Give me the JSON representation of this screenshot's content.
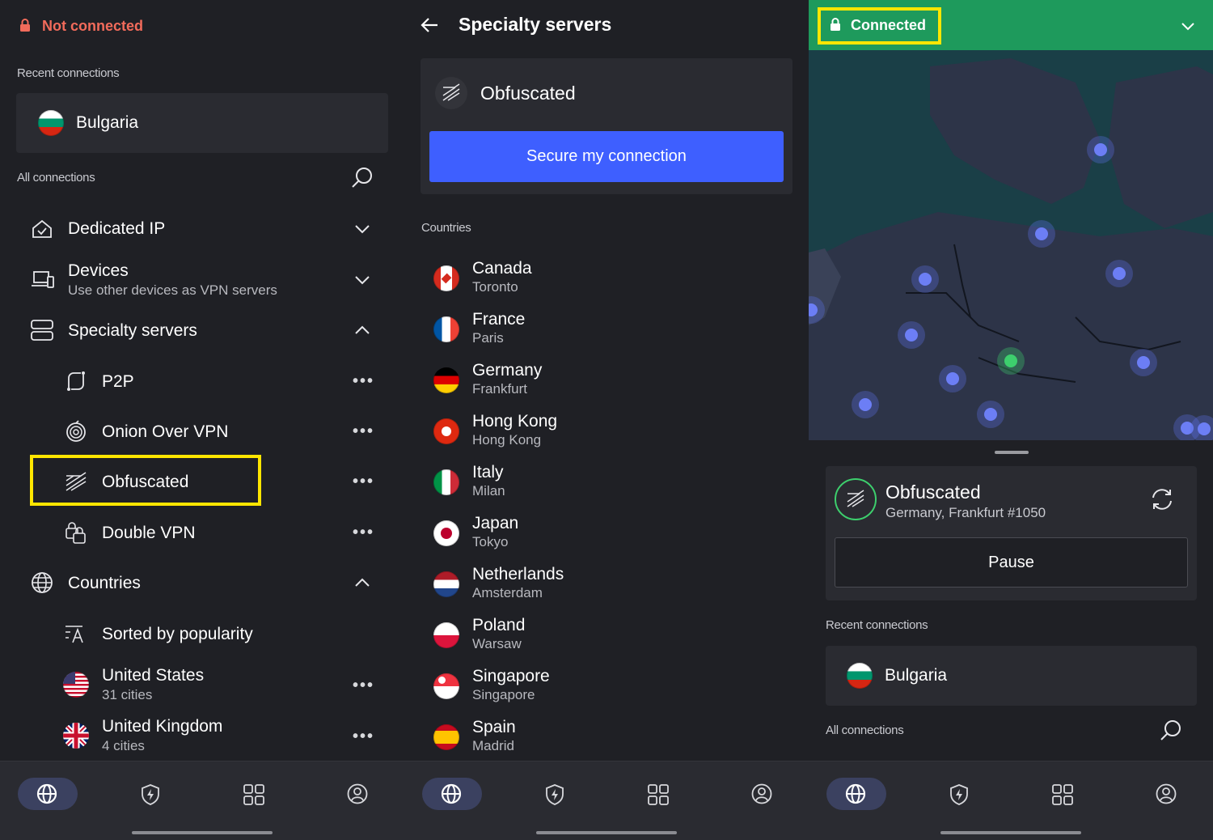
{
  "left": {
    "status": "Not connected",
    "recent_label": "Recent connections",
    "recent_item": "Bulgaria",
    "all_label": "All connections",
    "groups": {
      "dedicated": "Dedicated IP",
      "devices": "Devices",
      "devices_sub": "Use other devices as VPN servers",
      "specialty": "Specialty servers",
      "countries": "Countries"
    },
    "specialty_items": {
      "p2p": "P2P",
      "onion": "Onion Over VPN",
      "obfuscated": "Obfuscated",
      "double": "Double VPN"
    },
    "sort_label": "Sorted by popularity",
    "countries": [
      {
        "name": "United States",
        "sub": "31 cities"
      },
      {
        "name": "United Kingdom",
        "sub": "4 cities"
      }
    ]
  },
  "middle": {
    "title": "Specialty servers",
    "card_title": "Obfuscated",
    "secure_button": "Secure my connection",
    "countries_label": "Countries",
    "countries": [
      {
        "name": "Canada",
        "city": "Toronto"
      },
      {
        "name": "France",
        "city": "Paris"
      },
      {
        "name": "Germany",
        "city": "Frankfurt"
      },
      {
        "name": "Hong Kong",
        "city": "Hong Kong"
      },
      {
        "name": "Italy",
        "city": "Milan"
      },
      {
        "name": "Japan",
        "city": "Tokyo"
      },
      {
        "name": "Netherlands",
        "city": "Amsterdam"
      },
      {
        "name": "Poland",
        "city": "Warsaw"
      },
      {
        "name": "Singapore",
        "city": "Singapore"
      },
      {
        "name": "Spain",
        "city": "Madrid"
      }
    ]
  },
  "right": {
    "status": "Connected",
    "server_type": "Obfuscated",
    "server_location": "Germany, Frankfurt #1050",
    "pause_button": "Pause",
    "recent_label": "Recent connections",
    "recent_item": "Bulgaria",
    "all_label": "All connections"
  },
  "colors": {
    "background": "#1f2025",
    "card": "#2a2b31",
    "accent_blue": "#3e5fff",
    "connected_green": "#1e9a5c",
    "not_connected_red": "#f26b5b",
    "highlight_yellow": "#ffe600"
  },
  "icons": [
    "lock-icon",
    "back-arrow-icon",
    "search-icon",
    "chevron-down-icon",
    "chevron-up-icon",
    "globe-icon",
    "shield-bolt-icon",
    "grid-icon",
    "profile-icon",
    "refresh-icon",
    "obfuscated-icon"
  ]
}
